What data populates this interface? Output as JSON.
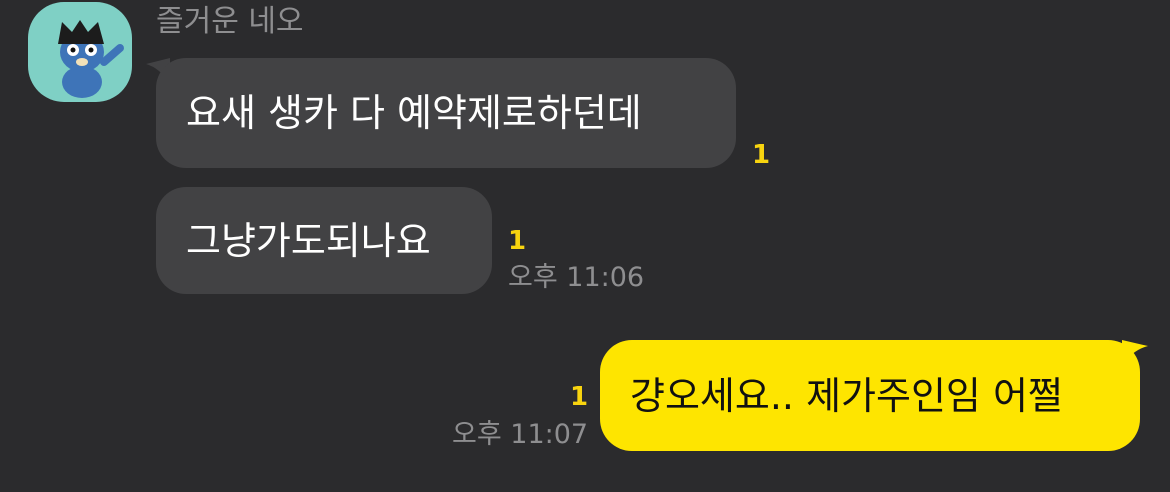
{
  "sender": {
    "name": "즐거운 네오"
  },
  "messages": [
    {
      "direction": "incoming",
      "text": "요새 생카 다 예약제로하던데",
      "unread": "1"
    },
    {
      "direction": "incoming",
      "text": "그냥가도되나요",
      "unread": "1",
      "time": "오후 11:06"
    },
    {
      "direction": "outgoing",
      "text": "걍오세요.. 제가주인임 어쩔",
      "unread": "1",
      "time": "오후 11:07"
    }
  ],
  "colors": {
    "background": "#2b2b2d",
    "incoming_bubble": "#424244",
    "outgoing_bubble": "#fee500",
    "unread": "#f8d40f",
    "muted_text": "#8e8e90"
  }
}
